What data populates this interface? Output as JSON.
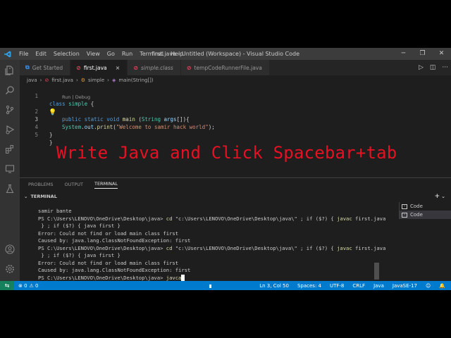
{
  "window": {
    "title": "first.java - Untitled (Workspace) - Visual Studio Code",
    "logo_icon": "vscode-logo-icon",
    "controls": [
      "─",
      "❐",
      "✕"
    ]
  },
  "menu": [
    "File",
    "Edit",
    "Selection",
    "View",
    "Go",
    "Run",
    "Terminal",
    "Help"
  ],
  "tabs": [
    {
      "label": "Get Started",
      "icon": "vscode-icon",
      "active": false
    },
    {
      "label": "first.java",
      "icon": "java-icon",
      "active": true,
      "close": "×"
    },
    {
      "label": "simple.class",
      "icon": "class-file-icon",
      "active": false
    },
    {
      "label": "tempCodeRunnerFile.java",
      "icon": "java-icon",
      "active": false
    }
  ],
  "breadcrumb": [
    "java",
    "first.java",
    "simple",
    "main(String[])"
  ],
  "codelens": "Run | Debug",
  "code": {
    "line_numbers": [
      "1",
      "2",
      "3",
      "4",
      "5"
    ],
    "l1": {
      "kw": "class",
      "name": "simple",
      "rest": " {"
    },
    "l2": {
      "mods": "public static void",
      "fn": "main",
      "open": " (",
      "type": "String",
      "arg": "args",
      "rest": "[]){"
    },
    "l3": {
      "obj": "System",
      "dot1": ".",
      "field": "out",
      "dot2": ".",
      "fn": "print",
      "open": "(",
      "str": "\"Welcome to samir hack world\"",
      "rest": ");"
    },
    "l4": "}",
    "l5": "}"
  },
  "overlay_text": "Write Java and Click Spacebar+tab",
  "panel": {
    "tabs": [
      "PROBLEMS",
      "OUTPUT",
      "TERMINAL"
    ],
    "section_title": "TERMINAL",
    "add_icon": "+",
    "dropdown_icon": "⌄",
    "terminals": [
      "Code",
      "Code"
    ]
  },
  "terminal": {
    "lines": [
      {
        "text": "samir bante"
      },
      {
        "prompt": "PS C:\\Users\\LENOVO\\OneDrive\\Desktop\\java> ",
        "cmd": "cd",
        "rest": " \"c:\\Users\\LENOVO\\OneDrive\\Desktop\\java\\\" ; if ($?) { ",
        "cmd2": "javac",
        "rest2": " first.java"
      },
      {
        "text": " } ; if ($?) { java first }"
      },
      {
        "text": "Error: Could not find or load main class first"
      },
      {
        "text": "Caused by: java.lang.ClassNotFoundException: first"
      },
      {
        "prompt": "PS C:\\Users\\LENOVO\\OneDrive\\Desktop\\java> ",
        "cmd": "cd",
        "rest": " \"c:\\Users\\LENOVO\\OneDrive\\Desktop\\java\\\" ; if ($?) { ",
        "cmd2": "javac",
        "rest2": " first.java"
      },
      {
        "text": " } ; if ($?) { java first }"
      },
      {
        "text": "Error: Could not find or load main class first"
      },
      {
        "text": "Caused by: java.lang.ClassNotFoundException: first"
      },
      {
        "prompt": "PS C:\\Users\\LENOVO\\OneDrive\\Desktop\\java> ",
        "cmd": "javca"
      }
    ]
  },
  "status": {
    "errors": "⊗ 0",
    "warnings": "⚠ 0",
    "position": "Ln 3, Col 50",
    "spaces": "Spaces: 4",
    "encoding": "UTF-8",
    "eol": "CRLF",
    "language": "Java",
    "runtime": "JavaSE-17"
  },
  "colors": {
    "accent": "#007acc",
    "overlay": "#e81123",
    "keyword": "#569cd6",
    "string": "#ce9178"
  }
}
